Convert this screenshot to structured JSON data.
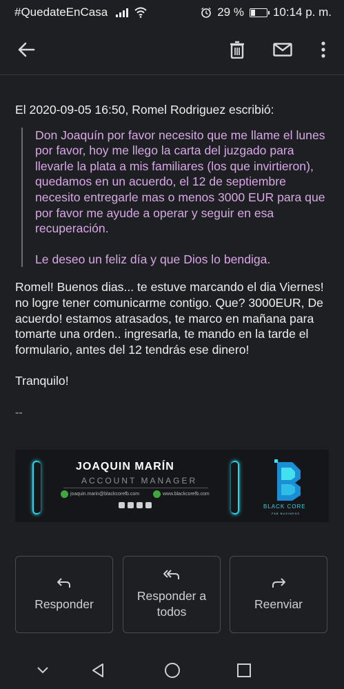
{
  "status_bar": {
    "hashtag": "#QuedateEnCasa",
    "battery_percent": "29 %",
    "time": "10:14 p. m."
  },
  "toolbar": {
    "back_icon": "arrow-back-icon",
    "delete_icon": "trash-icon",
    "mark_unread_icon": "envelope-icon",
    "more_icon": "more-vert-icon"
  },
  "email": {
    "quote_header": "El 2020-09-05 16:50, Romel Rodriguez escribió:",
    "quoted_paragraphs": [
      "Don Joaquín por favor necesito que me llame el lunes por favor, hoy me llego la carta del juzgado para llevarle la plata a mis familiares (los que invirtieron), quedamos en un acuerdo, el 12 de septiembre necesito entregarle mas o menos 3000 EUR para que por favor me ayude a operar y seguir en esa recuperación.",
      "Le deseo un feliz día y que Dios lo bendiga."
    ],
    "reply_paragraphs": [
      "Romel! Buenos dias... te estuve marcando el dia Viernes! no logre tener comunicarme contigo. Que? 3000EUR, De acuerdo! estamos atrasados, te marco en mañana para tomarte una orden.. ingresarla, te mando en la tarde el formulario, antes del 12 tendrás ese dinero!",
      "Tranquilo!"
    ],
    "signature_separator": "--"
  },
  "signature_banner": {
    "name": "JOAQUIN MARÍN",
    "role": "ACCOUNT MANAGER",
    "email": "joaquin.marin@blackcorefb.com",
    "website": "www.blackcorefb.com",
    "company": "BLACK CORE",
    "company_sub": "FAB BUSINESS",
    "accent_color": "#27d3e6"
  },
  "actions": [
    {
      "label": "Responder",
      "icon": "reply-icon"
    },
    {
      "label": "Responder a todos",
      "icon": "reply-all-icon"
    },
    {
      "label": "Reenviar",
      "icon": "forward-icon"
    }
  ],
  "nav_bar": {
    "collapse_icon": "chevron-down-icon",
    "back_icon": "triangle-back-icon",
    "home_icon": "circle-home-icon",
    "recents_icon": "square-recents-icon"
  }
}
